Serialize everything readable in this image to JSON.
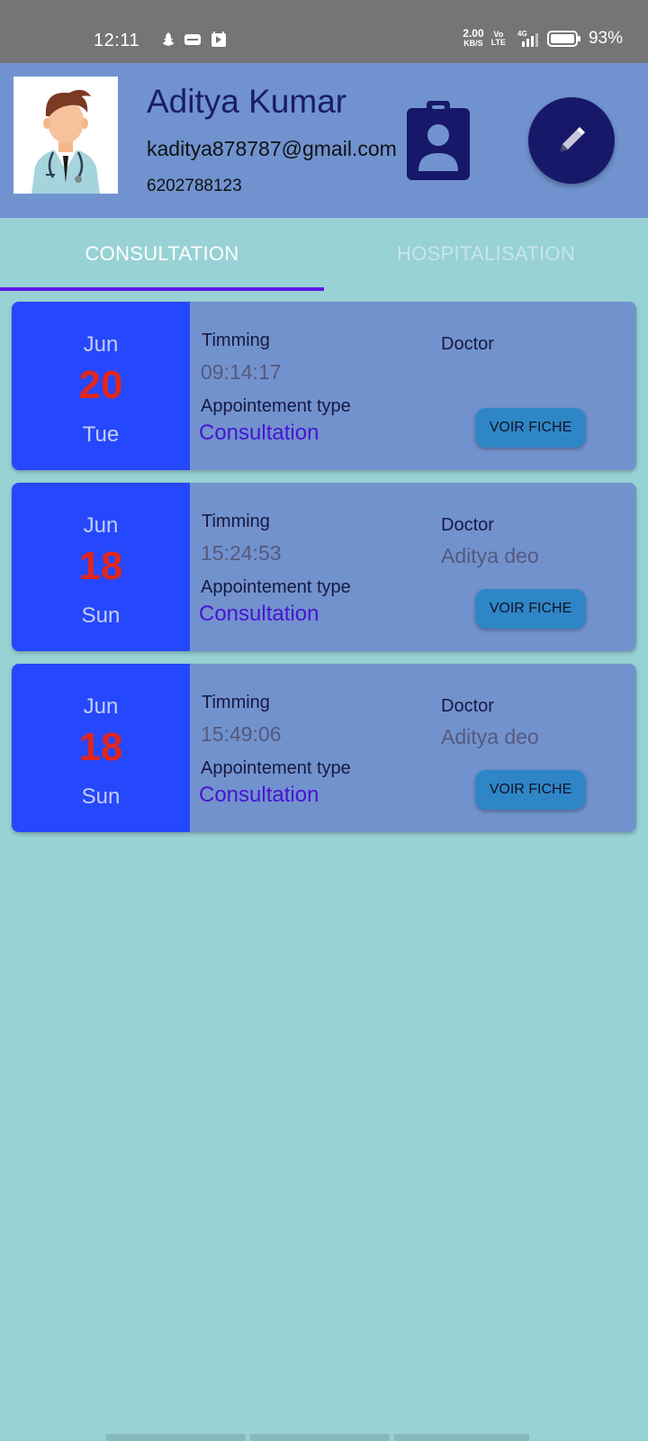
{
  "status_bar": {
    "time": "12:11",
    "net_speed_value": "2.00",
    "net_speed_unit": "KB/S",
    "volte_top": "Vo",
    "volte_bottom": "LTE",
    "signal_label": "4G",
    "battery_percent": "93%",
    "icons": [
      "snapchat-icon",
      "notification-icon",
      "gallery-icon",
      "wifi-icon",
      "signal-icon",
      "battery-icon"
    ]
  },
  "profile": {
    "name": "Aditya Kumar",
    "email": "kaditya878787@gmail.com",
    "phone": "6202788123",
    "avatar_icon": "doctor-avatar",
    "badge_icon": "id-badge-icon",
    "edit_icon": "pencil-icon"
  },
  "tabs": [
    {
      "label": "CONSULTATION",
      "selected": true
    },
    {
      "label": "HOSPITALISATION",
      "selected": false
    }
  ],
  "appointments": [
    {
      "month": "Jun",
      "day": "20",
      "weekday": "Tue",
      "timing_label": "Timming",
      "timing": "09:14:17",
      "type_label": "Appointement type",
      "type": "Consultation",
      "doctor_label": "Doctor",
      "doctor": "",
      "button_label": "VOIR FICHE"
    },
    {
      "month": "Jun",
      "day": "18",
      "weekday": "Sun",
      "timing_label": "Timming",
      "timing": "15:24:53",
      "type_label": "Appointement type",
      "type": "Consultation",
      "doctor_label": "Doctor",
      "doctor": "Aditya deo",
      "button_label": "VOIR FICHE"
    },
    {
      "month": "Jun",
      "day": "18",
      "weekday": "Sun",
      "timing_label": "Timming",
      "timing": "15:49:06",
      "type_label": "Appointement type",
      "type": "Consultation",
      "doctor_label": "Doctor",
      "doctor": "Aditya deo",
      "button_label": "VOIR FICHE"
    }
  ],
  "colors": {
    "background": "#98d2d5",
    "header": "#7093cf",
    "card": "#7292ce",
    "date_panel": "#2548fd",
    "day_number": "#e1261c",
    "tab_indicator": "#5f17e6",
    "button": "#2f86c6"
  }
}
